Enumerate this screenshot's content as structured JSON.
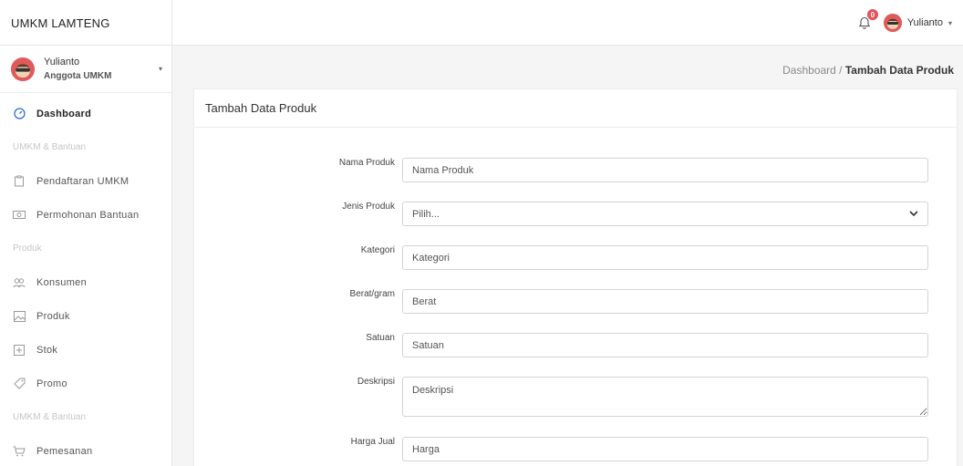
{
  "app": {
    "brand": "UMKM LAMTENG"
  },
  "topbar": {
    "notification_count": "0",
    "user_name": "Yulianto",
    "caret": "▾"
  },
  "sidebar": {
    "user": {
      "name": "Yulianto",
      "role": "Anggota UMKM",
      "caret": "▾"
    },
    "items": [
      {
        "type": "link",
        "label": "Dashboard",
        "icon": "dashboard-icon",
        "active": true
      },
      {
        "type": "heading",
        "label": "UMKM & Bantuan"
      },
      {
        "type": "link",
        "label": "Pendaftaran UMKM",
        "icon": "clipboard-icon"
      },
      {
        "type": "link",
        "label": "Permohonan Bantuan",
        "icon": "money-icon"
      },
      {
        "type": "heading",
        "label": "Produk"
      },
      {
        "type": "link",
        "label": "Konsumen",
        "icon": "users-icon"
      },
      {
        "type": "link",
        "label": "Produk",
        "icon": "image-icon"
      },
      {
        "type": "link",
        "label": "Stok",
        "icon": "plus-box-icon"
      },
      {
        "type": "link",
        "label": "Promo",
        "icon": "tag-icon"
      },
      {
        "type": "heading",
        "label": "UMKM & Bantuan"
      },
      {
        "type": "link",
        "label": "Pemesanan",
        "icon": "cart-icon"
      }
    ]
  },
  "breadcrumb": {
    "parent": "Dashboard",
    "separator": " / ",
    "current": "Tambah Data Produk"
  },
  "card": {
    "title": "Tambah Data Produk"
  },
  "form": {
    "nama_produk": {
      "label": "Nama Produk",
      "placeholder": "Nama Produk"
    },
    "jenis_produk": {
      "label": "Jenis Produk",
      "selected": "Pilih..."
    },
    "kategori": {
      "label": "Kategori",
      "placeholder": "Kategori"
    },
    "berat": {
      "label": "Berat/gram",
      "placeholder": "Berat"
    },
    "satuan": {
      "label": "Satuan",
      "placeholder": "Satuan"
    },
    "deskripsi": {
      "label": "Deskripsi",
      "placeholder": "Deskripsi"
    },
    "harga_jual": {
      "label": "Harga Jual",
      "placeholder": "Harga"
    }
  },
  "colors": {
    "badge": "#e8505b",
    "avatar": "#e05a5a",
    "active_icon": "#2f6fd6",
    "muted_heading": "#c6c6c6"
  }
}
